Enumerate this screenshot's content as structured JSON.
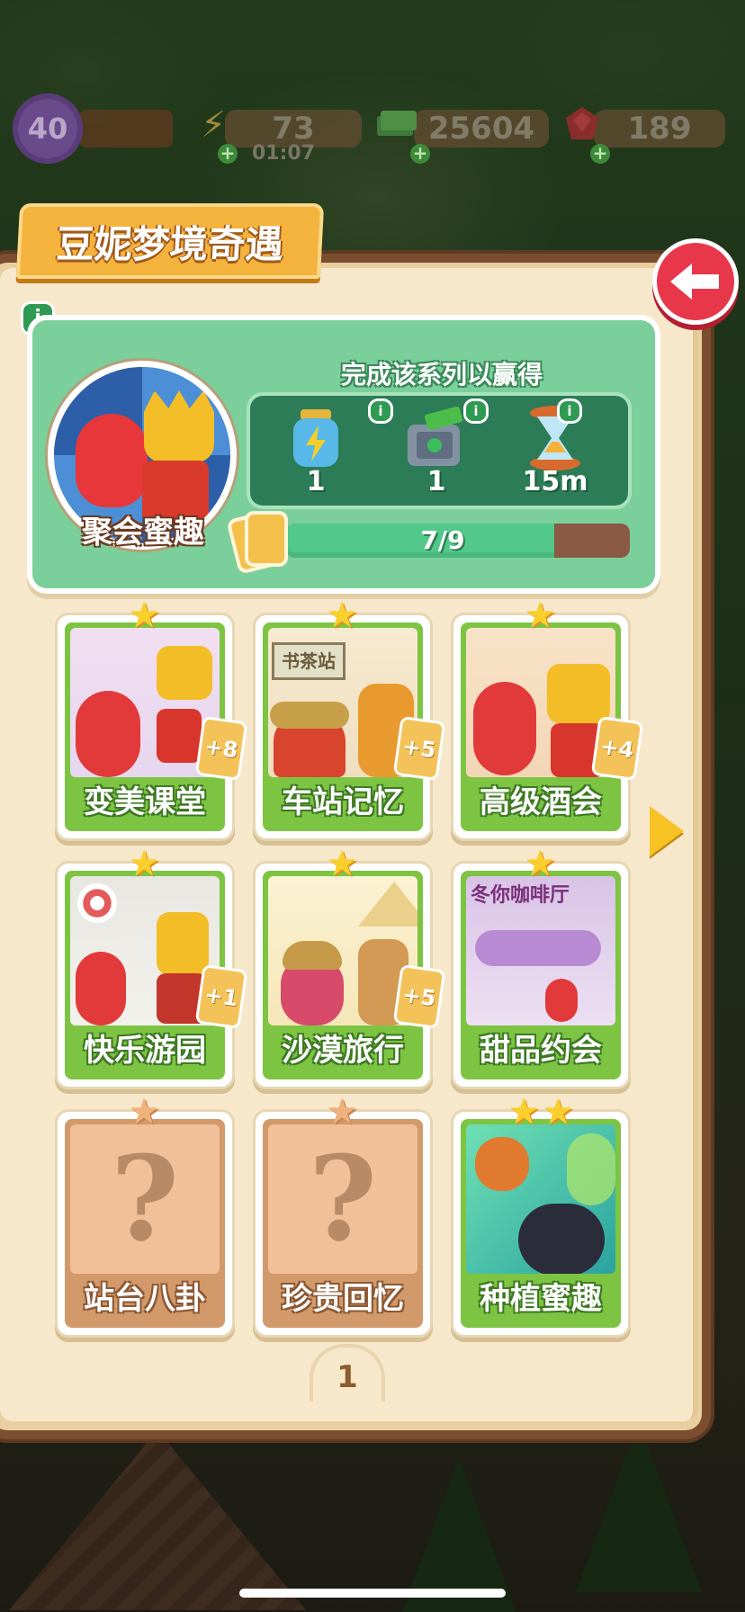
{
  "status_bar": {
    "level": "40",
    "energy": "73",
    "energy_timer": "01:07",
    "cash": "25604",
    "gems": "189"
  },
  "album": {
    "title": "豆妮梦境奇遇",
    "reward_heading": "完成该系列以赢得",
    "collection_name": "聚会蜜趣",
    "progress_text": "7/9",
    "progress_fraction": 0.78,
    "rewards": [
      {
        "icon": "energy-jar-icon",
        "count": "1"
      },
      {
        "icon": "cash-safe-icon",
        "count": "1"
      },
      {
        "icon": "hourglass-icon",
        "count": "15m"
      }
    ],
    "page_number": "1"
  },
  "cards": [
    {
      "name": "变美课堂",
      "stars": 1,
      "duplicates": "+8",
      "locked": false
    },
    {
      "name": "车站记忆",
      "stars": 1,
      "duplicates": "+5",
      "locked": false
    },
    {
      "name": "高级酒会",
      "stars": 1,
      "duplicates": "+4",
      "locked": false
    },
    {
      "name": "快乐游园",
      "stars": 1,
      "duplicates": "+1",
      "locked": false
    },
    {
      "name": "沙漠旅行",
      "stars": 1,
      "duplicates": "+5",
      "locked": false
    },
    {
      "name": "甜品约会",
      "stars": 1,
      "duplicates": "",
      "locked": false
    },
    {
      "name": "站台八卦",
      "stars": 1,
      "duplicates": "",
      "locked": true
    },
    {
      "name": "珍贵回忆",
      "stars": 1,
      "duplicates": "",
      "locked": true
    },
    {
      "name": "种植蜜趣",
      "stars": 2,
      "duplicates": "",
      "locked": false
    }
  ],
  "card_pic_texts": {
    "station_sign": "书茶站",
    "cafe_sign": "冬你咖啡厅"
  },
  "colors": {
    "card_frame_green": "#7ec443",
    "card_frame_locked": "#d29a6a",
    "accent_gold": "#f3b33d",
    "back_button_red": "#e8374a",
    "progress_green": "#52c98a"
  },
  "icons": {
    "back": "back-arrow-icon",
    "info": "info-icon",
    "next_page": "next-page-arrow-icon",
    "star": "star-icon"
  }
}
